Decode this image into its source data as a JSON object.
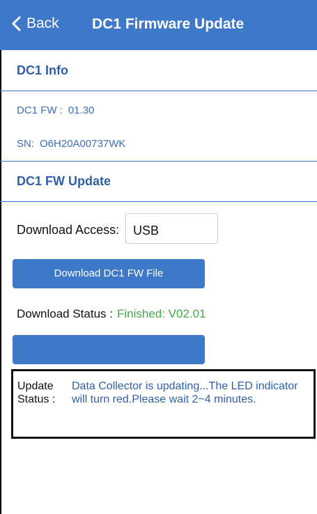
{
  "header": {
    "back_label": "Back",
    "title": "DC1 Firmware Update",
    "color": "#3e78c9"
  },
  "info_section": {
    "heading": "DC1 Info",
    "fw_label": "DC1 FW :",
    "fw_value": "01.30",
    "sn_label": "SN:",
    "sn_value": "O6H20A00737WK"
  },
  "update_section": {
    "heading": "DC1 FW Update",
    "access_label": "Download Access:",
    "access_value": "USB",
    "download_button": "Download DC1 FW File",
    "status_label": "Download Status :",
    "status_value": "Finished: V02.01",
    "status_color": "#46a84a",
    "update_button": "",
    "update_status_label": "Update Status :",
    "update_status_text": "Data Collector is updating...The LED indicator will turn red.Please wait 2~4 minutes."
  }
}
